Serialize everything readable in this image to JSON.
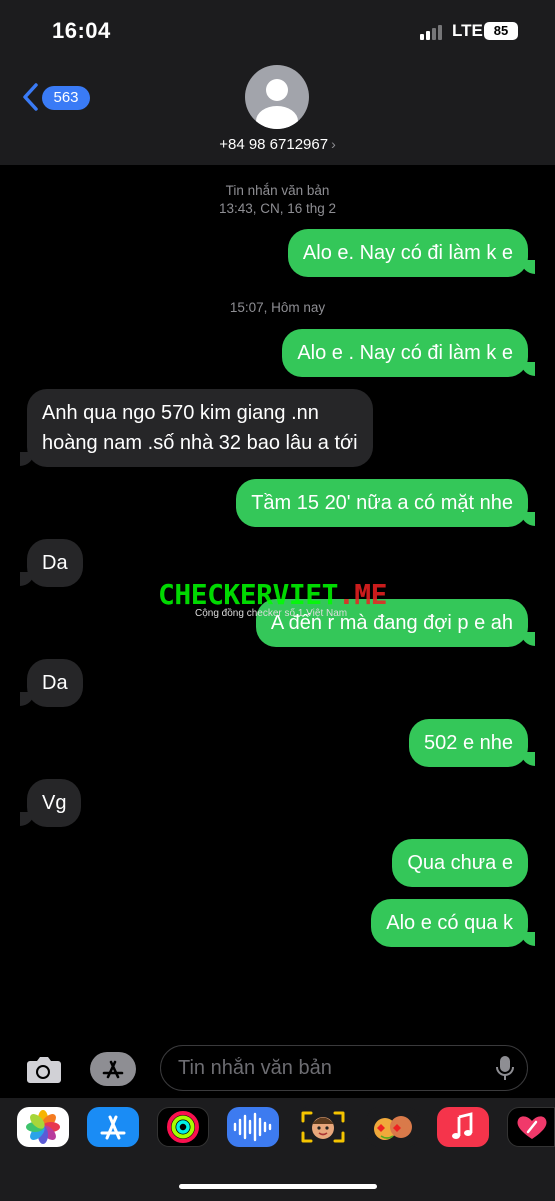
{
  "status_bar": {
    "time": "16:04",
    "network": "LTE",
    "battery": "85"
  },
  "header": {
    "back_count": "563",
    "contact": "+84 98 6712967"
  },
  "thread": {
    "timestamp1": {
      "line1": "Tin nhắn văn bản",
      "line2": "13:43, CN, 16 thg 2"
    },
    "timestamp2": "15:07, Hôm nay",
    "messages": [
      {
        "direction": "outgoing",
        "text": "Alo e. Nay có đi làm k e"
      },
      {
        "direction": "outgoing",
        "text": "Alo e . Nay có đi làm k e"
      },
      {
        "direction": "incoming",
        "text": "Anh qua ngo 570 kim giang .nn\nhoàng nam .số nhà 32 bao lâu a tới"
      },
      {
        "direction": "outgoing",
        "text": "Tầm 15 20' nữa a có mặt nhe"
      },
      {
        "direction": "incoming",
        "text": "Da"
      },
      {
        "direction": "outgoing",
        "text": "A đến r mà đang đợi p e ah"
      },
      {
        "direction": "incoming",
        "text": "Da"
      },
      {
        "direction": "outgoing",
        "text": "502 e nhe"
      },
      {
        "direction": "incoming",
        "text": "Vg"
      },
      {
        "direction": "outgoing",
        "text": "Qua chưa e"
      },
      {
        "direction": "outgoing",
        "text": "Alo e có qua k"
      }
    ]
  },
  "watermark": {
    "main": "CHECKERVIET",
    "suffix": ".ME",
    "sub": "Cộng đồng checker số 1 Việt Nam"
  },
  "input": {
    "placeholder": "Tin nhắn văn bản",
    "value": ""
  },
  "app_drawer": [
    "photos",
    "app-store",
    "activity",
    "voice-memos",
    "memoji",
    "animoji",
    "music",
    "digital-touch"
  ],
  "colors": {
    "outgoing": "#34c759",
    "incoming": "#262628",
    "accent": "#3a7bf6",
    "background": "#000000"
  }
}
